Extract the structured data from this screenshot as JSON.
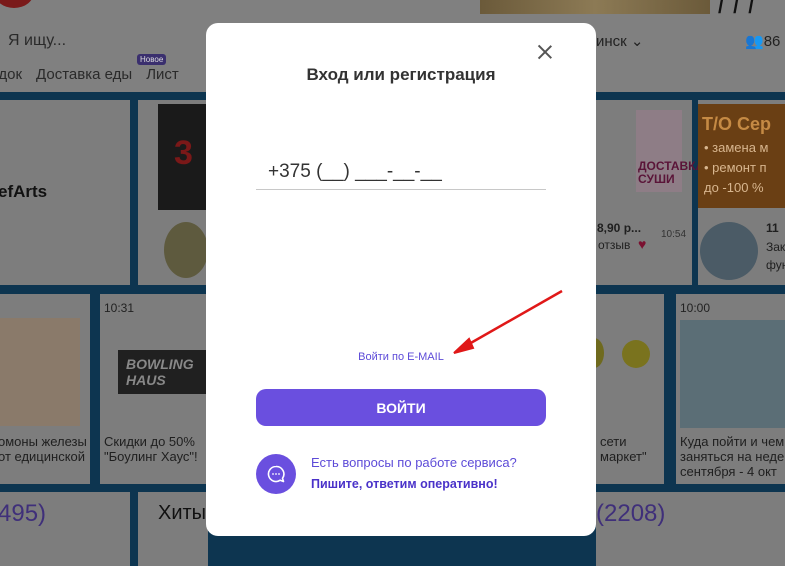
{
  "background": {
    "search_placeholder": "Я ищу...",
    "city": "инск ⌄",
    "user_count": "86",
    "nav": [
      "идок",
      "Доставка еды",
      "Лист"
    ],
    "nav_badge": "Новое",
    "chef_name": "efArts",
    "time_left": "10:31",
    "time_right": "10:00",
    "bowling_logo": "BOWLING HAUS",
    "card_left_text": "омоны железы от едицинской",
    "card_mid_text": "Скидки до 50% \"Боулинг Хаус\"!",
    "card_right1_text": "сети маркет\"",
    "card_right2_text": "Куда пойти и чем заняться на неде сентября - 4 окт",
    "price_text": "8,90 р...",
    "reviews_text": "отзыв",
    "time_1054": "10:54",
    "promo_11": "11",
    "promo_za": "Зак фун",
    "promo_number": "3",
    "sushi_text": "ДОСТАВКА СУШИ",
    "orange_title": "Т/О Сер",
    "orange_item1": "• замена м",
    "orange_item2": "• ремонт п",
    "orange_item3": "до -100 %",
    "count_left": "495)",
    "count_right": "(2208)",
    "hits": "Хиты"
  },
  "modal": {
    "title": "Вход или регистрация",
    "phone_value": "+375 (__) ___-__-__",
    "email_link": "Войти по E-MAIL",
    "login_button": "ВОЙТИ",
    "support_question": "Есть вопросы по работе сервиса?",
    "support_link": "Пишите, ответим оперативно!"
  },
  "colors": {
    "accent": "#6a4fdf",
    "link": "#5d4bd8",
    "annotation_arrow": "#e01818",
    "overlay": "#808080"
  },
  "icons": {
    "close": "close-icon",
    "chat": "chat-bubble-icon",
    "annotation": "red-arrow-annotation"
  }
}
